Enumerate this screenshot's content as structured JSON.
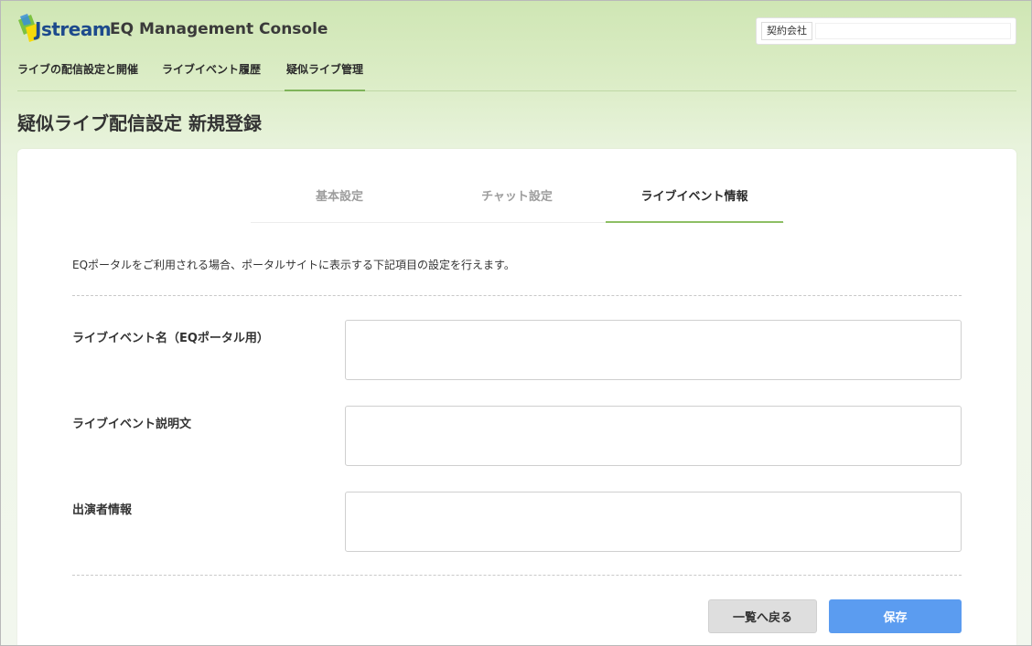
{
  "header": {
    "logo_text": "Jstream",
    "console_title": "EQ Management Console",
    "contract": {
      "label": "契約会社",
      "value": ""
    }
  },
  "global_nav": {
    "items": [
      {
        "label": "ライブの配信設定と開催"
      },
      {
        "label": "ライブイベント履歴"
      },
      {
        "label": "疑似ライブ管理",
        "active": true
      }
    ]
  },
  "page": {
    "title": "疑似ライブ配信設定 新規登録"
  },
  "tabs": [
    {
      "label": "基本設定"
    },
    {
      "label": "チャット設定"
    },
    {
      "label": "ライブイベント情報",
      "active": true
    }
  ],
  "form": {
    "intro": "EQポータルをご利用される場合、ポータルサイトに表示する下記項目の設定を行えます。",
    "fields": [
      {
        "label": "ライブイベント名（EQポータル用）",
        "value": ""
      },
      {
        "label": "ライブイベント説明文",
        "value": ""
      },
      {
        "label": "出演者情報",
        "value": ""
      }
    ]
  },
  "actions": {
    "back_label": "一覧へ戻る",
    "save_label": "保存"
  },
  "colors": {
    "accent_green": "#8dbf64",
    "save_blue": "#5b9cf0",
    "logo_blue": "#1d4a8c",
    "logo_green": "#7cc242",
    "logo_yellow": "#f5d90a"
  }
}
